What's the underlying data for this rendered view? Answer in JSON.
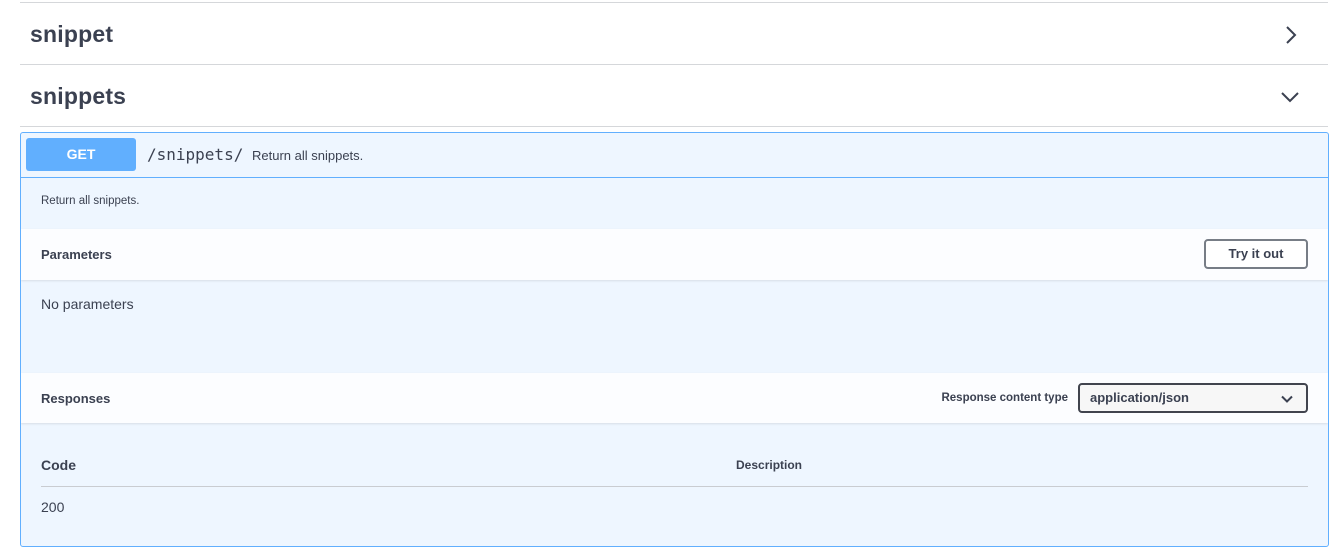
{
  "tags": [
    {
      "name": "snippet",
      "expanded": false,
      "chevron_icon": "chevron-right-icon"
    },
    {
      "name": "snippets",
      "expanded": true,
      "chevron_icon": "chevron-down-icon"
    }
  ],
  "operation": {
    "method": "GET",
    "path": "/snippets/",
    "summary": "Return all snippets.",
    "description": "Return all snippets.",
    "method_color": "#61affe"
  },
  "parameters": {
    "title": "Parameters",
    "try_button_label": "Try it out",
    "empty_text": "No parameters"
  },
  "responses": {
    "title": "Responses",
    "content_type_label": "Response content type",
    "content_type_value": "application/json",
    "columns": {
      "code": "Code",
      "description": "Description"
    },
    "rows": [
      {
        "code": "200",
        "description": ""
      }
    ]
  }
}
